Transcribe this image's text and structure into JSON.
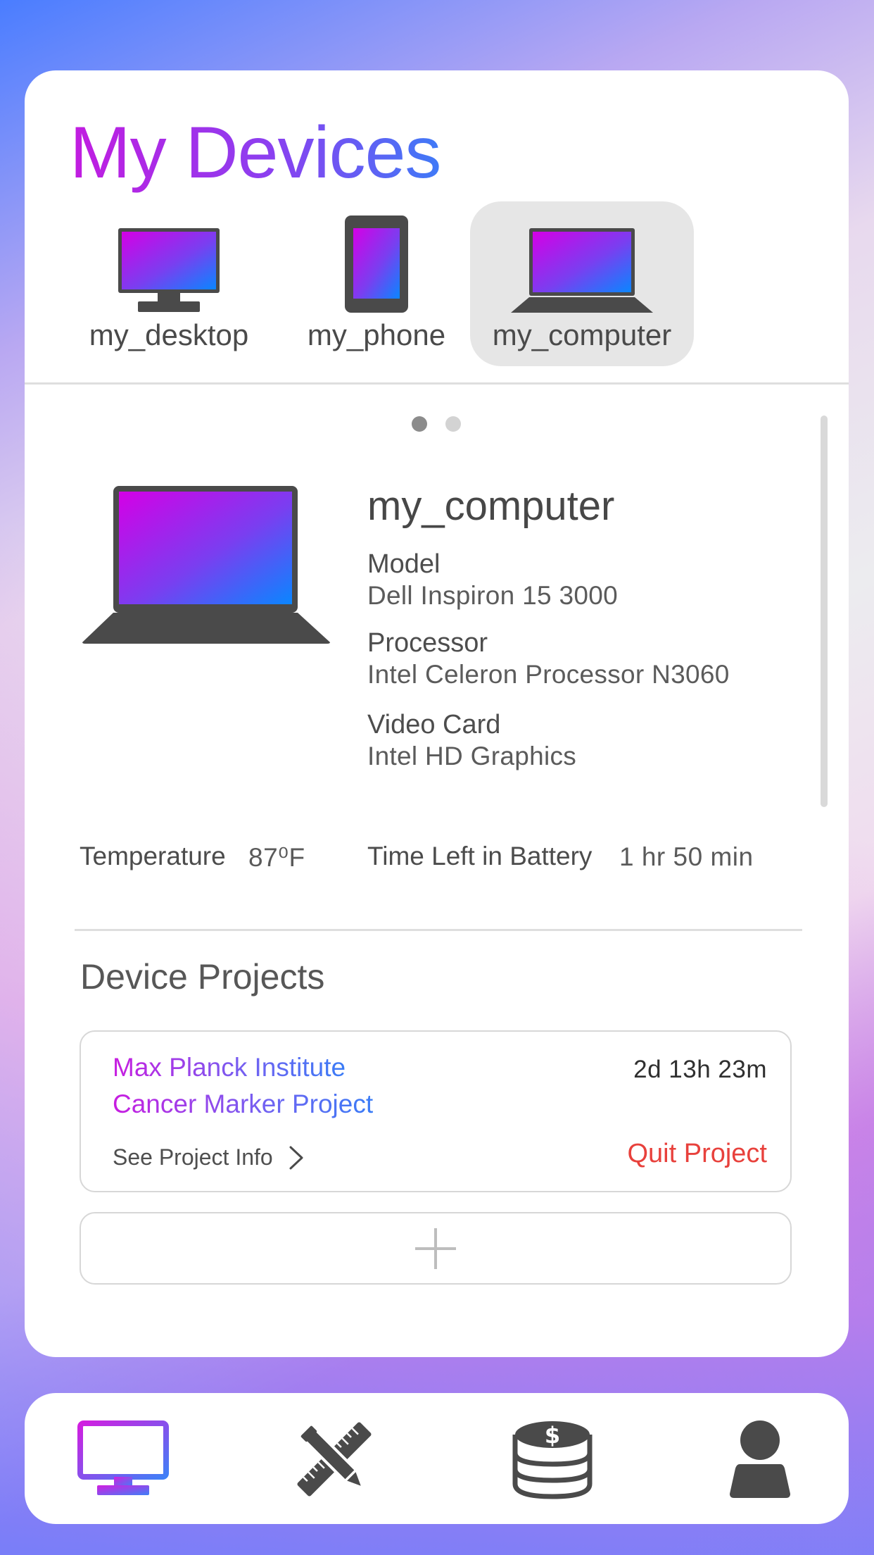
{
  "header": {
    "title": "My Devices"
  },
  "devices": [
    {
      "label": "my_desktop",
      "icon": "desktop-icon",
      "active": false
    },
    {
      "label": "my_phone",
      "icon": "phone-icon",
      "active": false
    },
    {
      "label": "my_computer",
      "icon": "laptop-icon",
      "active": true
    }
  ],
  "pager": {
    "pages": 2,
    "current": 1
  },
  "detail": {
    "name": "my_computer",
    "specs": [
      {
        "label": "Model",
        "value": "Dell Inspiron 15 3000"
      },
      {
        "label": "Processor",
        "value": "Intel Celeron Processor N3060"
      },
      {
        "label": "Video Card",
        "value": "Intel HD Graphics"
      }
    ],
    "stats": {
      "temperature_label": "Temperature",
      "temperature_value": "87⁰F",
      "battery_label": "Time Left in Battery",
      "battery_value": "1 hr 50 min"
    }
  },
  "projects": {
    "title": "Device Projects",
    "items": [
      {
        "org": "Max Planck Institute",
        "name": "Cancer Marker Project",
        "time_left": "2d 13h 23m",
        "info_label": "See Project Info",
        "quit_label": "Quit Project"
      }
    ],
    "add_icon": "plus-icon"
  },
  "bottom_nav": [
    {
      "name": "devices",
      "icon": "monitor-icon",
      "active": true
    },
    {
      "name": "tools",
      "icon": "pencil-ruler-icon",
      "active": false
    },
    {
      "name": "credits",
      "icon": "coin-stack-icon",
      "active": false
    },
    {
      "name": "profile",
      "icon": "user-icon",
      "active": false
    }
  ],
  "colors": {
    "accent_start": "#c81de0",
    "accent_end": "#3a7cf6",
    "quit": "#e8413c",
    "icon_gray": "#4a4a4a",
    "active_tab_bg": "#e6e6e6"
  }
}
